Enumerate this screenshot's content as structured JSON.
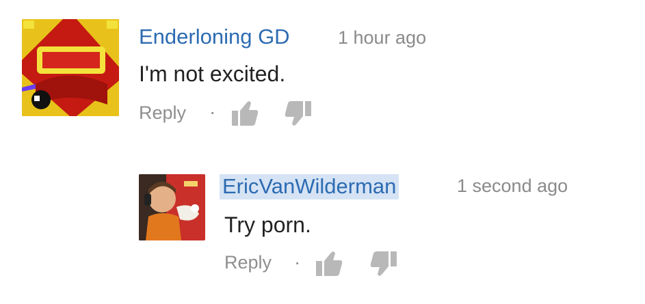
{
  "comments": [
    {
      "author": "Enderloning GD",
      "time": "1 hour ago",
      "text": "I'm not excited.",
      "reply_label": "Reply",
      "separator": "·"
    },
    {
      "author": "EricVanWilderman",
      "time": "1 second ago",
      "text": "Try porn.",
      "reply_label": "Reply",
      "separator": "·"
    }
  ],
  "icons": {
    "like": "thumbs-up-icon",
    "dislike": "thumbs-down-icon"
  },
  "colors": {
    "author_link": "#2c6bb2",
    "author_highlight": "#d5e3f4",
    "meta_gray": "#8a8a8a",
    "comment_text": "#222222",
    "icon_gray": "#b8b8b8"
  }
}
